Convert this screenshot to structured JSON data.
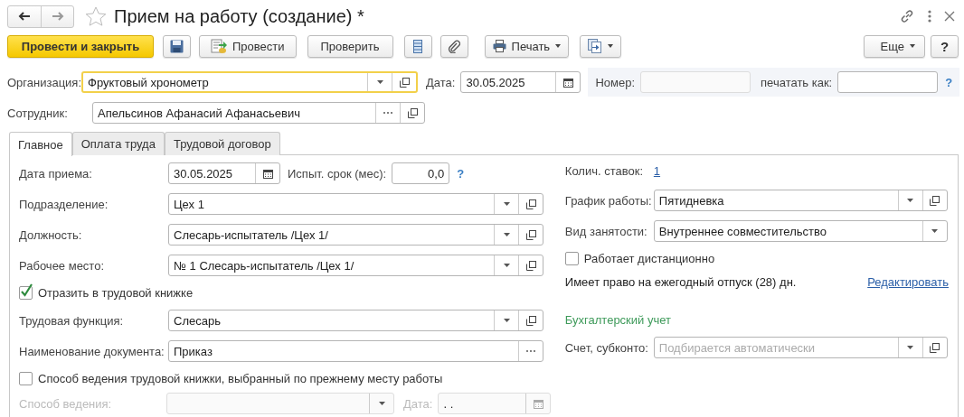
{
  "window": {
    "title": "Прием на работу (создание) *"
  },
  "toolbar": [
    {
      "kind": "primary",
      "label": "Провести и закрыть"
    },
    {
      "kind": "save"
    },
    {
      "kind": "post",
      "label": "Провести"
    },
    {
      "kind": "plain",
      "label": "Проверить"
    },
    {
      "kind": "list"
    },
    {
      "kind": "attach"
    },
    {
      "kind": "print",
      "label": "Печать"
    },
    {
      "kind": "related"
    },
    {
      "kind": "menu",
      "label": "Еще"
    },
    {
      "kind": "help",
      "label": "?"
    }
  ],
  "header": {
    "organization": {
      "label": "Организация:",
      "value": "Фруктовый хронометр",
      "focused": true
    },
    "date": {
      "label": "Дата:",
      "value": "30.05.2025"
    },
    "number": {
      "label": "Номер:",
      "disabled": true
    },
    "print_as": {
      "label": "печатать как:"
    },
    "help": "?",
    "employee": {
      "label": "Сотрудник:",
      "value": "Апельсинов Афанасий Афанасьевич"
    }
  },
  "tabs": [
    {
      "label": "Главное",
      "selected": true
    },
    {
      "label": "Оплата труда",
      "selected": false
    },
    {
      "label": "Трудовой договор",
      "selected": false
    }
  ],
  "left": [
    {
      "kind": "date_trial",
      "label": "Дата приема:",
      "value": "30.05.2025",
      "trial_label": "Испыт. срок (мес):",
      "trial_value": "0,0",
      "help": "?"
    },
    {
      "kind": "select_open",
      "label": "Подразделение:",
      "value": "Цех 1"
    },
    {
      "kind": "select_open",
      "label": "Должность:",
      "value": "Слесарь-испытатель /Цех 1/"
    },
    {
      "kind": "select_open",
      "label": "Рабочее место:",
      "value": "№ 1 Слесарь-испытатель /Цех 1/"
    },
    {
      "kind": "checkbox",
      "label": "Отразить в трудовой книжке",
      "checked": true
    },
    {
      "kind": "select_open",
      "label": "Трудовая функция:",
      "value": "Слесарь"
    },
    {
      "kind": "pick",
      "label": "Наименование документа:",
      "value": "Приказ"
    },
    {
      "kind": "checkbox",
      "label": "Способ ведения трудовой книжки, выбранный по прежнему месту работы",
      "checked": false
    },
    {
      "kind": "method",
      "label": "Способ ведения:",
      "date_label": "Дата:",
      "date_value": ". .",
      "disabled": true
    }
  ],
  "right": [
    {
      "kind": "link_value",
      "label": "Колич. ставок:",
      "value": "1"
    },
    {
      "kind": "select_open",
      "label": "График работы:",
      "value": "Пятидневка"
    },
    {
      "kind": "select",
      "label": "Вид занятости:",
      "value": "Внутреннее совместительство"
    },
    {
      "kind": "checkbox",
      "label": "Работает дистанционно",
      "checked": false
    },
    {
      "kind": "note",
      "text": "Имеет право на ежегодный отпуск (28) дн.",
      "link": "Редактировать"
    },
    {
      "kind": "section",
      "text": "Бухгалтерский учет"
    },
    {
      "kind": "select_open",
      "label": "Счет, субконто:",
      "placeholder": "Подбирается автоматически"
    }
  ]
}
